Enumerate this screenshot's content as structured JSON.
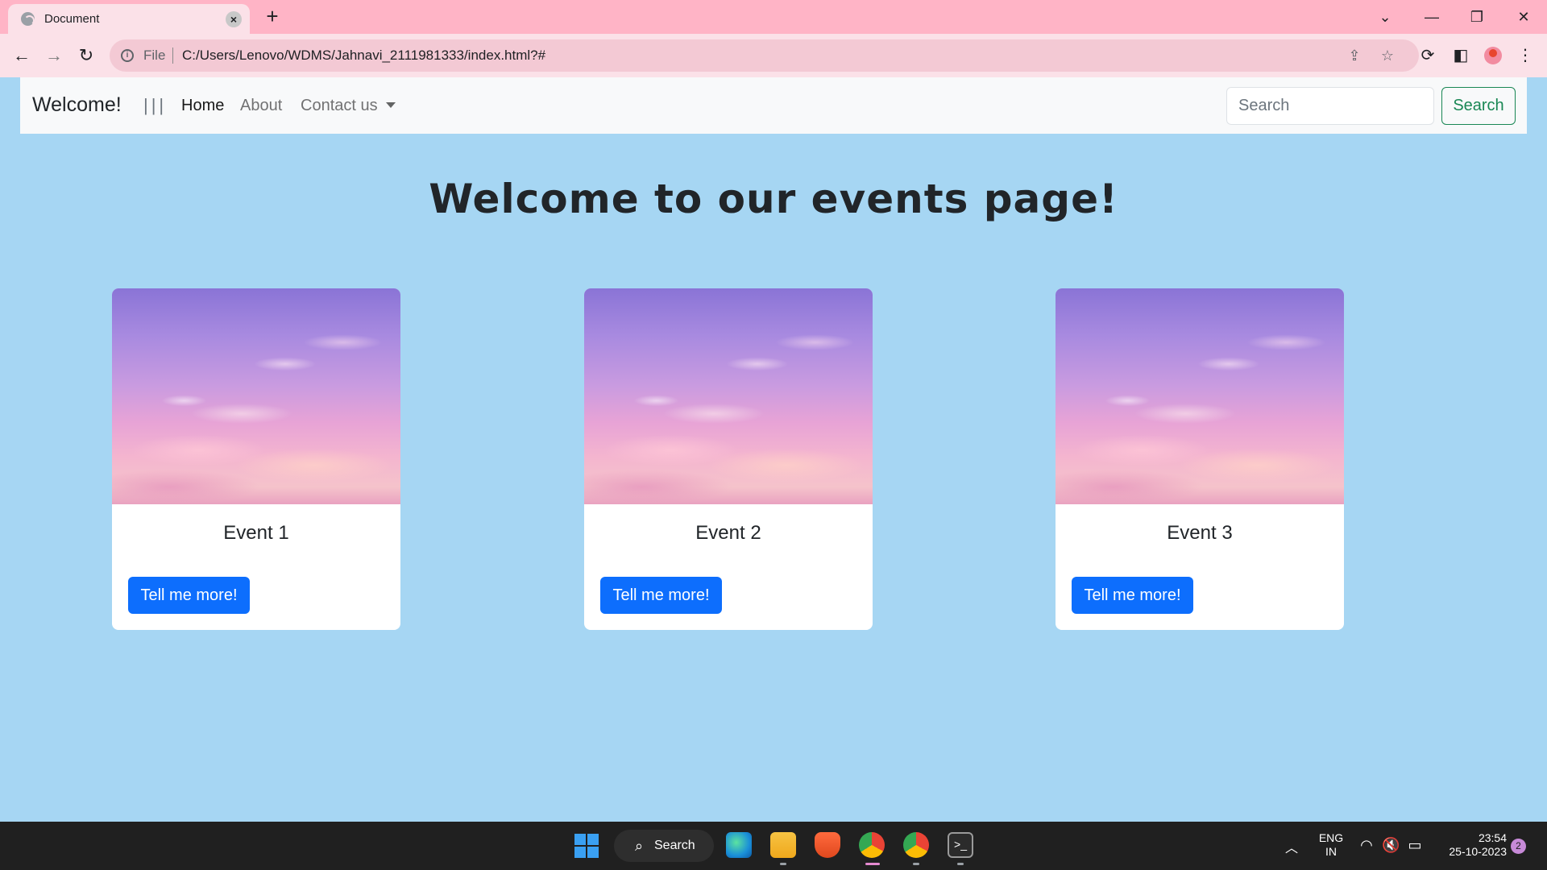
{
  "browser": {
    "tab_title": "Document",
    "tab_close": "×",
    "new_tab": "+",
    "url_scheme_label": "File",
    "url": "C:/Users/Lenovo/WDMS/Jahnavi_2111981333/index.html?#"
  },
  "navbar": {
    "brand": "Welcome!",
    "divider": "|||",
    "links": [
      "Home",
      "About",
      "Contact us"
    ],
    "search_placeholder": "Search",
    "search_button": "Search"
  },
  "page": {
    "heading": "Welcome to our events page!",
    "cards": [
      {
        "title": "Event 1",
        "button": "Tell me more!"
      },
      {
        "title": "Event 2",
        "button": "Tell me more!"
      },
      {
        "title": "Event 3",
        "button": "Tell me more!"
      }
    ]
  },
  "taskbar": {
    "search_label": "Search",
    "language": "ENG",
    "region": "IN",
    "time": "23:54",
    "date": "25-10-2023",
    "notification_count": "2"
  },
  "colors": {
    "page_background": "#a6d6f3",
    "primary_button": "#0d6efd",
    "search_outline": "#198754",
    "browser_frame": "#ffb4c6"
  }
}
